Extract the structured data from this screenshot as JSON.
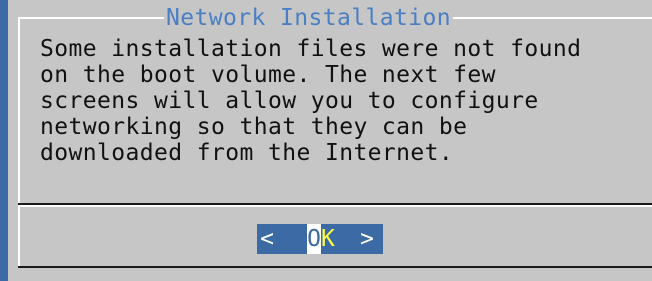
{
  "dialog": {
    "title": "Network Installation",
    "message": "Some installation files were not found\non the boot volume. The next few\nscreens will allow you to configure\nnetworking so that they can be\ndownloaded from the Internet.",
    "button": {
      "left_arrow": "<",
      "hotkey": "O",
      "rest": "K",
      "right_arrow": ">"
    }
  },
  "colors": {
    "background": "#3b6aa4",
    "dialog": "#c6c6c6",
    "title": "#4a7fc4",
    "button_hotkey_label": "#ffff44"
  }
}
